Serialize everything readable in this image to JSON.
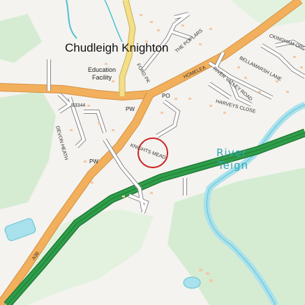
{
  "map": {
    "place_name": "Chudleigh Knighton",
    "facility_line1": "Education",
    "facility_line2": "Facility",
    "river_line1": "River",
    "river_line2": "Teign",
    "labels": {
      "b3344": "B3344",
      "devon_heath": "DEVON HEATH",
      "pw_north": "PW",
      "pw_south": "PW",
      "po": "PO",
      "ford_pk": "FORD PK",
      "the_poplars": "THE POPLARS",
      "homelea": "HOMELEA",
      "river_valley_road": "RIVER VALLEY ROAD",
      "bellamarsh_lane": "BELLAMARSH LANE",
      "harveys_close": "HARVEYS CLOSE",
      "knights_mead": "KNIGHTS MEAD",
      "a38": "A38",
      "ckingham_orch": "CKINGHAM ORCH"
    },
    "colors": {
      "background": "#f4f3ef",
      "woodland": "#d5ecd3",
      "water": "#a9e1ec",
      "major_road": "#f2b05c",
      "b_road": "#f4de8a",
      "trunk_road": "#2f9d4a",
      "minor_road": "#ffffff",
      "building": "#f3c9a8",
      "marker": "#cc2222"
    }
  }
}
